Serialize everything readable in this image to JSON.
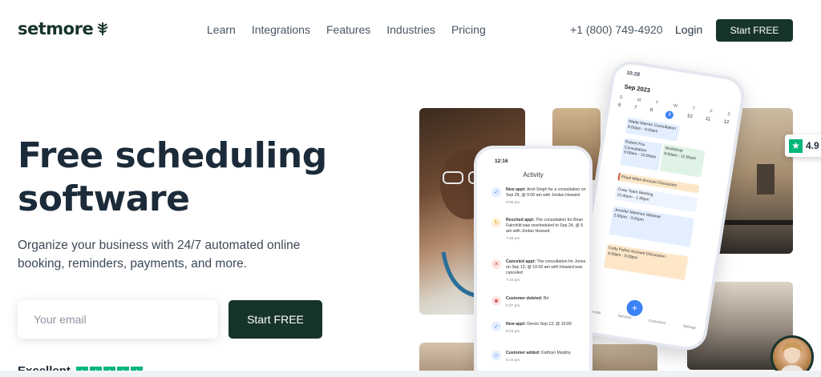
{
  "header": {
    "logo_text": "setmore",
    "nav": [
      "Learn",
      "Integrations",
      "Features",
      "Industries",
      "Pricing"
    ],
    "phone": "+1 (800) 749-4920",
    "login": "Login",
    "cta": "Start FREE"
  },
  "hero": {
    "title_line1": "Free scheduling",
    "title_line2": "software",
    "subtitle_line1": "Organize your business with 24/7 automated online",
    "subtitle_line2": "booking, reminders, payments, and more.",
    "email_placeholder": "Your email",
    "cta": "Start FREE",
    "review_label": "Excellent"
  },
  "trust_badge": {
    "rating": "4.9"
  },
  "calendar_phone": {
    "time": "10:28",
    "month": "Sep 2023",
    "weekdays": [
      "S",
      "M",
      "T",
      "W",
      "T",
      "F",
      "S"
    ],
    "dates": [
      "6",
      "7",
      "8",
      "9",
      "10",
      "11",
      "12"
    ],
    "selected_date": "9",
    "events": [
      {
        "name": "Wade Warren",
        "detail": "Consultation",
        "time": "8:00am - 9:00am"
      },
      {
        "name": "Robert Fox",
        "detail": "Consultation",
        "time": "9:00am - 10:00am"
      },
      {
        "name": "Workshop",
        "detail": "",
        "time": "9:00am - 11:00am"
      },
      {
        "name": "Floyd Miles",
        "detail": "Account Discussion",
        "time": ""
      },
      {
        "name": "Crew Team Meeting",
        "detail": "",
        "time": "12:45pm - 1:45pm"
      },
      {
        "name": "Jennifer Martinez",
        "detail": "Webinar",
        "time": "2:00pm - 3:00pm"
      },
      {
        "name": "Cody Fisher",
        "detail": "Account Discussion",
        "time": "4:00pm - 5:00pm"
      }
    ],
    "tabs": [
      "Calendar",
      "Services",
      "Customers",
      "Settings"
    ]
  },
  "activity_phone": {
    "time": "12:16",
    "title": "Activity",
    "items": [
      {
        "label": "New appt:",
        "text": "Arsh Singh for a consultation on Sep 28, @ 9:00 am with Jordan Howard",
        "time": "9:05 pm"
      },
      {
        "label": "Resched appt:",
        "text": "The consultation for Brian Fairchild was rescheduled to Sep 24, @ 9 am with Jordan Howard",
        "time": "7:49 pm"
      },
      {
        "label": "Canceled appt:",
        "text": "The consultation for Jones on Sep 13, @ 10:00 am with Howard was canceled",
        "time": "7:15 pm"
      },
      {
        "label": "Customer deleted:",
        "text": "Bri",
        "time": "5:37 pm"
      },
      {
        "label": "New appt:",
        "text": "Devon Sep 13, @ 10:00",
        "time": "5:23 pm"
      },
      {
        "label": "Customer added:",
        "text": "Kathryn Murphy",
        "time": "5:16 pm"
      }
    ]
  },
  "colors": {
    "brand_dark": "#17342c",
    "trustpilot": "#00b67a",
    "calendar_accent": "#3b82f6"
  }
}
